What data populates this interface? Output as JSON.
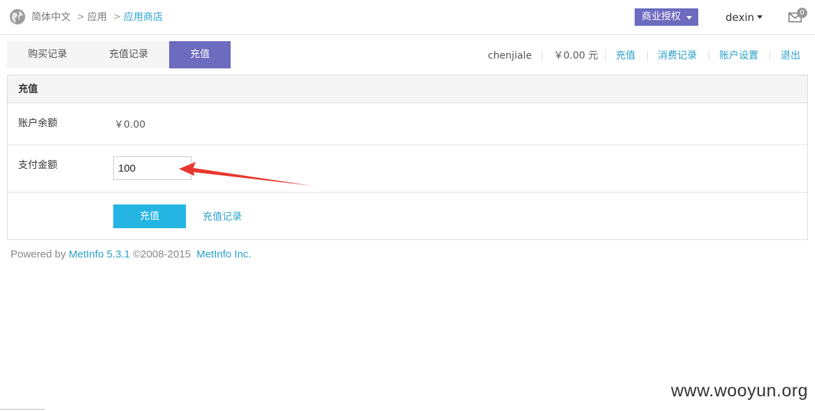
{
  "breadcrumb": {
    "items": [
      "简体中文",
      "应用",
      "应用商店"
    ]
  },
  "header": {
    "license_button": "商业授权",
    "username": "dexin",
    "mail_badge": "0"
  },
  "tabs": [
    {
      "label": "购买记录"
    },
    {
      "label": "充值记录"
    },
    {
      "label": "充值"
    }
  ],
  "account": {
    "name": "chenjiale",
    "balance": "￥0.00 元",
    "links": [
      "充值",
      "消费记录",
      "账户设置",
      "退出"
    ]
  },
  "panel": {
    "title": "充值",
    "balance_label": "账户余额",
    "balance_value": "￥0.00",
    "amount_label": "支付金额",
    "amount_value": "100",
    "submit_label": "充值",
    "record_link": "充值记录"
  },
  "footer": {
    "powered_by": "Powered by",
    "product": "MetInfo 5.3.1",
    "copyright": "©2008-2015",
    "company": "MetInfo Inc."
  },
  "watermark": "www.wooyun.org",
  "colors": {
    "accent_purple": "#6c6bbf",
    "link_blue": "#2aa0cb",
    "button_blue": "#24b5e3",
    "arrow_red": "#e8382f"
  }
}
